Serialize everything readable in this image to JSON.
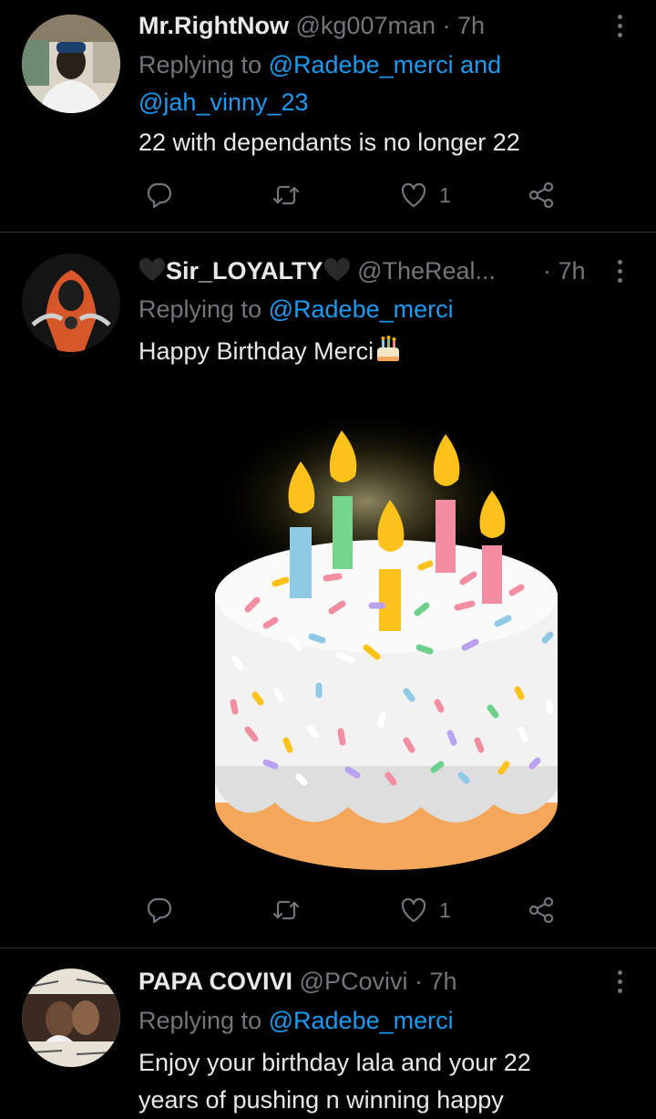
{
  "tweets": [
    {
      "name": "Mr.RightNow",
      "handle": "@kg007man",
      "time": "7h",
      "replying_prefix": "Replying to",
      "mentions_line1": "@Radebe_merci",
      "mentions_and": "and",
      "mentions_line2": "@jah_vinny_23",
      "text": "22 with dependants is no longer 22",
      "like_count": "1"
    },
    {
      "name": "Sir_LOYALTY",
      "handle": "@TheReal...",
      "time": "7h",
      "replying_prefix": "Replying to",
      "mention": "@Radebe_merci",
      "text": "Happy Birthday Merci",
      "like_count": "1"
    },
    {
      "name": "PAPA COVIVI",
      "handle": "@PCovivi",
      "time": "7h",
      "replying_prefix": "Replying to",
      "mention": "@Radebe_merci",
      "text_line1": "Enjoy your birthday lala and your 22",
      "text_line2": "years of pushing n winning happy"
    }
  ],
  "separator": "·",
  "icons": [
    "reply-icon",
    "retweet-icon",
    "like-icon",
    "share-icon",
    "more-icon",
    "birthday-cake-emoji",
    "black-heart-emoji"
  ],
  "colors": {
    "background": "#000000",
    "text": "#e7e9ea",
    "muted": "#71767b",
    "link": "#1d9bf0"
  }
}
